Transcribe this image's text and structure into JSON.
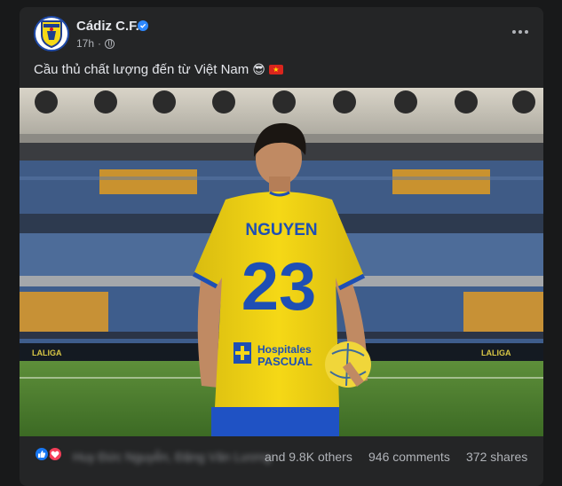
{
  "post": {
    "page_name": "Cádiz C.F.",
    "time": "17h",
    "separator": "·",
    "caption": "Cầu thủ chất lượng đến từ Việt Nam",
    "caption_emoji": "😎",
    "photo": {
      "jersey_name": "NGUYEN",
      "jersey_number": "23",
      "sponsor_line1": "Hospitales",
      "sponsor_line2": "PASCUAL",
      "board_text": "LALIGA"
    }
  },
  "footer": {
    "reactor_names": "Huy Đức Nguyễn, Đặng Văn Lương",
    "others": "and 9.8K others",
    "comments": "946 comments",
    "shares": "372 shares"
  },
  "icons": {
    "avatar": "cadiz-crest-icon",
    "verified": "verified-badge-icon",
    "privacy": "globe-icon",
    "more": "more-options-icon",
    "like": "like-reaction-icon",
    "love": "love-reaction-icon",
    "flag": "vietnam-flag-icon"
  },
  "colors": {
    "card_bg": "#242526",
    "page_bg": "#18191a",
    "text_primary": "#e4e6eb",
    "text_secondary": "#b0b3b8",
    "verified_blue": "#2d88ff",
    "jersey_yellow": "#f5d816",
    "jersey_blue": "#1e4fb4"
  }
}
